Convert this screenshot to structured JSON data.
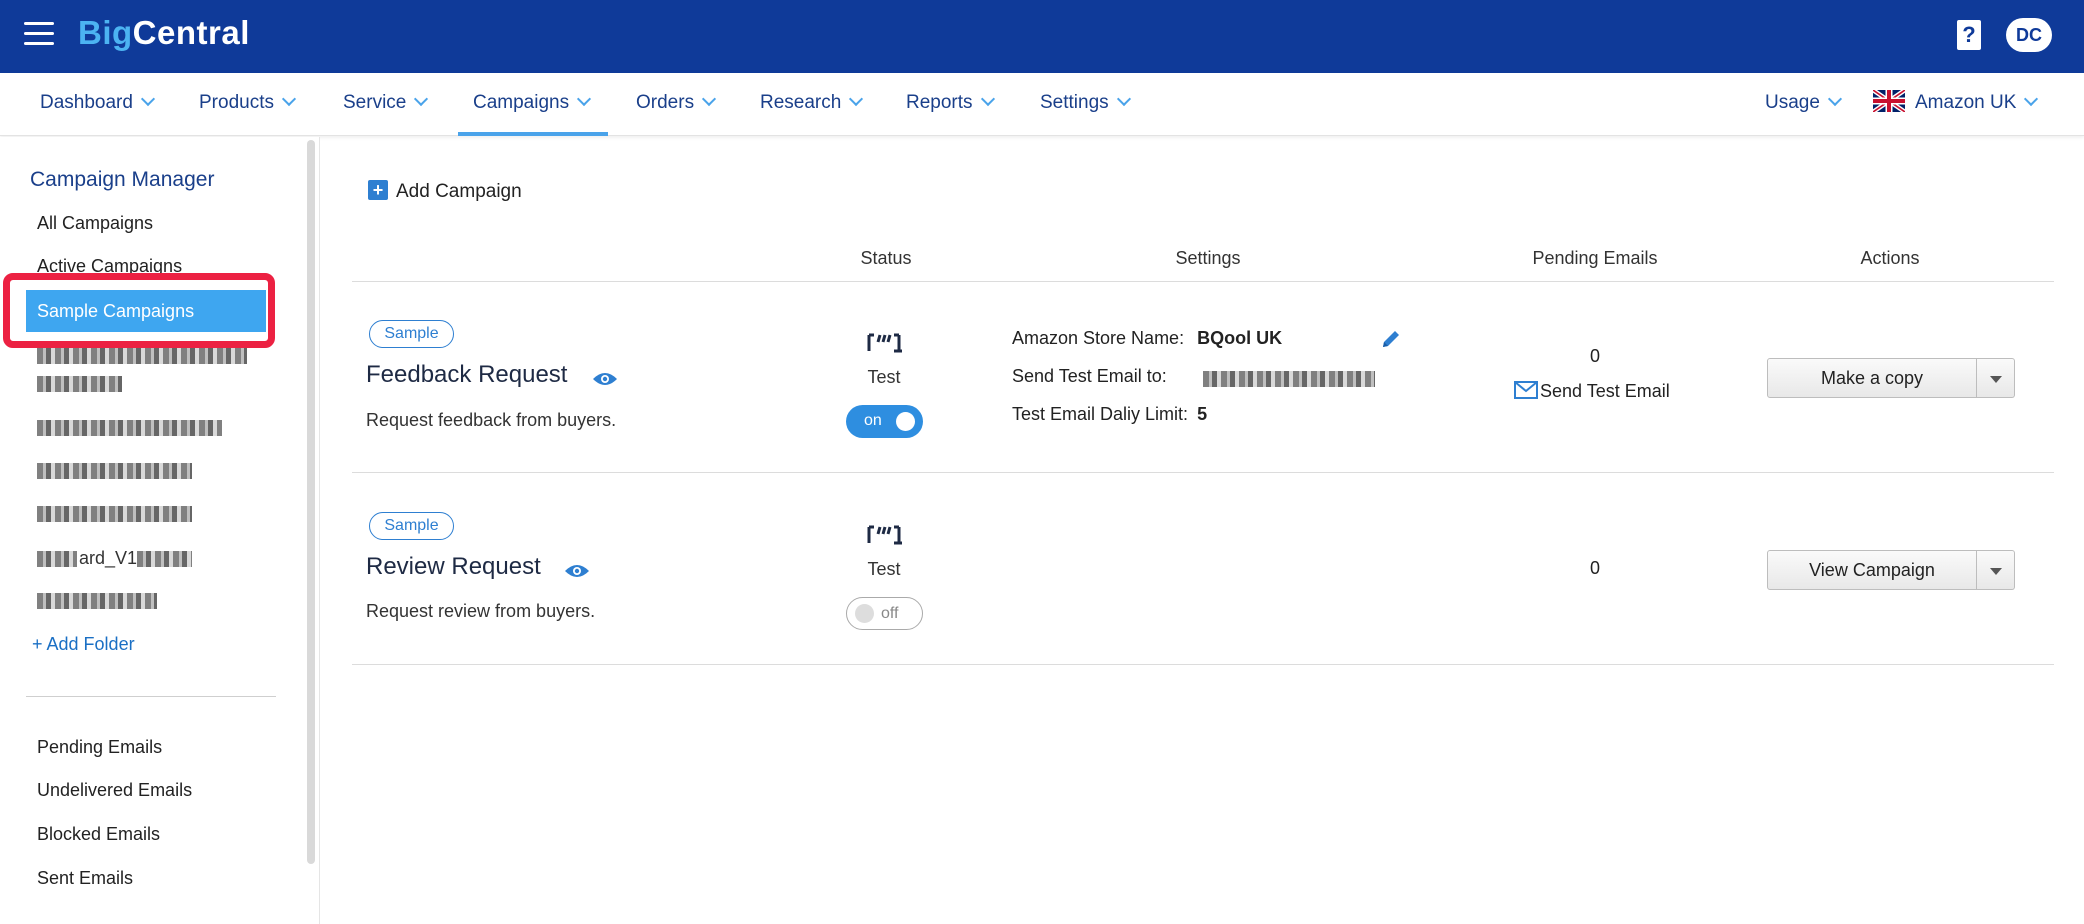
{
  "brand": {
    "part1": "Big",
    "part2": "Central"
  },
  "topbar": {
    "help_icon": "help-icon",
    "help_glyph": "?",
    "avatar_initials": "DC"
  },
  "nav": {
    "items": [
      {
        "label": "Dashboard"
      },
      {
        "label": "Products"
      },
      {
        "label": "Service"
      },
      {
        "label": "Campaigns"
      },
      {
        "label": "Orders"
      },
      {
        "label": "Research"
      },
      {
        "label": "Reports"
      },
      {
        "label": "Settings"
      }
    ],
    "active": "Campaigns",
    "usage_label": "Usage",
    "marketplace_label": "Amazon UK"
  },
  "sidebar": {
    "title": "Campaign Manager",
    "items": [
      "All Campaigns",
      "Active Campaigns",
      "Sample Campaigns"
    ],
    "selected": "Sample Campaigns",
    "partial_folder_text": "ard_V1",
    "add_folder_label": "+ Add Folder",
    "email_items": [
      "Pending Emails",
      "Undelivered Emails",
      "Blocked Emails",
      "Sent Emails"
    ]
  },
  "main": {
    "add_campaign_label": "Add Campaign",
    "columns": [
      "Status",
      "Settings",
      "Pending Emails",
      "Actions"
    ],
    "campaigns": [
      {
        "tag": "Sample",
        "name": "Feedback Request",
        "description": "Request feedback from buyers.",
        "status_label": "Test",
        "toggle": "on",
        "settings": {
          "store_label": "Amazon Store Name:",
          "store_value": "BQool UK",
          "test_email_label": "Send Test Email to:",
          "limit_label": "Test Email Daliy Limit:",
          "limit_value": "5"
        },
        "pending": "0",
        "send_test_label": "Send Test Email",
        "action_label": "Make a copy"
      },
      {
        "tag": "Sample",
        "name": "Review Request",
        "description": "Request review from buyers.",
        "status_label": "Test",
        "toggle": "off",
        "pending": "0",
        "action_label": "View Campaign"
      }
    ]
  },
  "colors": {
    "topbar": "#0f3a99",
    "accent": "#3ea6f0",
    "highlight": "#ec2142"
  }
}
